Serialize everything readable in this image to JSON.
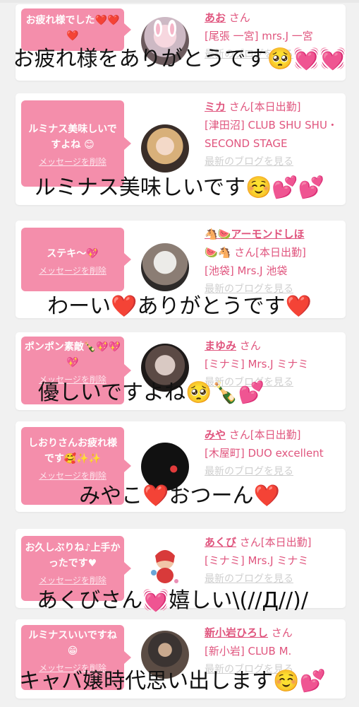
{
  "entries": [
    {
      "message": "お疲れ様でした❤️❤️❤️",
      "delete_label": "メッセージを削除",
      "name": "あお",
      "san": "さん",
      "shop": "[尾張 一宮] mrs.J 一宮",
      "blog_label": "最新のブログを見る",
      "avatar_icon": "avatar-bunny"
    },
    {
      "message": "ルミナス美味しいですよね 😊",
      "delete_label": "メッセージを削除",
      "name": "ミカ",
      "san": "さん[本日出勤]",
      "shop": "[津田沼] CLUB SHU SHU・SECOND STAGE",
      "blog_label": "最新のブログを見る",
      "avatar_icon": "avatar-blonde"
    },
    {
      "message": "ステキ〜💖",
      "delete_label": "メッセージを削除",
      "name": "🐴🍉アーモンドしほ",
      "name_suffix": "🍉🐴",
      "san": "さん[本日出勤]",
      "shop": "[池袋] Mrs.J 池袋",
      "blog_label": "最新のブログを見る",
      "avatar_icon": "avatar-cap"
    },
    {
      "message": "ポンポン素敵🍾💖💖💖",
      "delete_label": "メッセージを削除",
      "name": "まゆみ",
      "san": "さん",
      "shop": "[ミナミ] Mrs.J ミナミ",
      "blog_label": "最新のブログを見る",
      "avatar_icon": "avatar-bow"
    },
    {
      "message": "しおりさんお疲れ様です🥰✨✨",
      "delete_label": "メッセージを削除",
      "name": "みや",
      "san": "さん[本日出勤]",
      "shop": "[木屋町] DUO excellent",
      "blog_label": "最新のブログを見る",
      "avatar_icon": "avatar-dark"
    },
    {
      "message": "お久しぶりね♪上手かったです♥",
      "delete_label": "メッセージを削除",
      "name": "あくび",
      "san": "さん[本日出勤]",
      "shop": "[ミナミ] Mrs.J ミナミ",
      "blog_label": "最新のブログを見る",
      "avatar_icon": "avatar-cartoon"
    },
    {
      "message": "ルミナスいいですね😁",
      "delete_label": "メッセージを削除",
      "name": "新小岩ひろし",
      "san": "さん",
      "shop": "[新小岩] CLUB M.",
      "blog_label": "最新のブログを見る",
      "avatar_icon": "avatar-suit"
    }
  ],
  "overlays": [
    "お疲れ様をありがとうです🥺💓💓",
    "ルミナス美味しいです☺️💕💕",
    "わーい❤️ありがとうです❤️",
    "優しいですよね🥺🍾💕",
    "みやこ❤️おつーん❤️",
    "あくびさん💓嬉しい\\(//Д//)/",
    "キャバ嬢時代思い出します☺️💕"
  ]
}
